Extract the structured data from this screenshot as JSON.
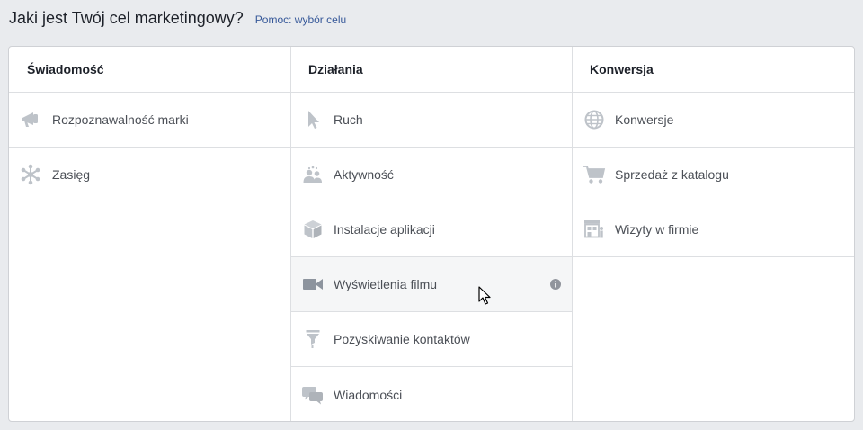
{
  "header": {
    "title": "Jaki jest Twój cel marketingowy?",
    "help_link": "Pomoc: wybór celu"
  },
  "columns": [
    {
      "title": "Świadomość",
      "items": [
        {
          "label": "Rozpoznawalność marki",
          "icon": "megaphone-icon"
        },
        {
          "label": "Zasięg",
          "icon": "reach-icon"
        }
      ]
    },
    {
      "title": "Działania",
      "items": [
        {
          "label": "Ruch",
          "icon": "pointer-icon"
        },
        {
          "label": "Aktywność",
          "icon": "people-icon"
        },
        {
          "label": "Instalacje aplikacji",
          "icon": "box-icon"
        },
        {
          "label": "Wyświetlenia filmu",
          "icon": "video-camera-icon",
          "hovered": true
        },
        {
          "label": "Pozyskiwanie kontaktów",
          "icon": "funnel-icon"
        },
        {
          "label": "Wiadomości",
          "icon": "chat-bubbles-icon"
        }
      ]
    },
    {
      "title": "Konwersja",
      "items": [
        {
          "label": "Konwersje",
          "icon": "globe-icon"
        },
        {
          "label": "Sprzedaż z katalogu",
          "icon": "cart-icon"
        },
        {
          "label": "Wizyty w firmie",
          "icon": "storefront-icon"
        }
      ]
    }
  ],
  "colors": {
    "icon": "#bec3c9",
    "icon_active": "#8d949e",
    "link": "#365899",
    "background": "#e9ebee"
  }
}
